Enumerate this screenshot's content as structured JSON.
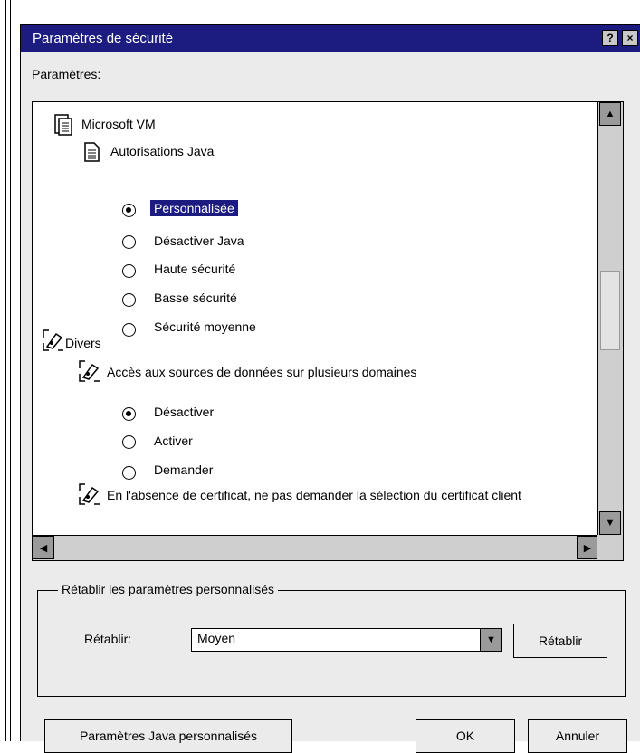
{
  "window": {
    "title": "Paramètres de sécurité",
    "help_button": "?",
    "close_button": "×"
  },
  "settings_label": "Paramètres:",
  "tree": {
    "microsoft_vm": "Microsoft VM",
    "java_permissions": "Autorisations Java",
    "java_options": [
      {
        "label": "Personnalisée",
        "checked": true
      },
      {
        "label": "Désactiver Java",
        "checked": false
      },
      {
        "label": "Haute sécurité",
        "checked": false
      },
      {
        "label": "Basse sécurité",
        "checked": false
      },
      {
        "label": "Sécurité moyenne",
        "checked": false
      }
    ],
    "misc": "Divers",
    "data_access": "Accès aux sources de données sur plusieurs domaines",
    "data_access_options": [
      {
        "label": "Désactiver",
        "checked": true
      },
      {
        "label": "Activer",
        "checked": false
      },
      {
        "label": "Demander",
        "checked": false
      }
    ],
    "no_cert": "En l'absence de certificat, ne pas demander la sélection du certificat client"
  },
  "reset_group": {
    "title": "Rétablir les paramètres personnalisés",
    "reset_label": "Rétablir:",
    "combo_value": "Moyen",
    "reset_button": "Rétablir"
  },
  "footer": {
    "java_custom_button": "Paramètres Java personnalisés",
    "ok_button": "OK",
    "cancel_button": "Annuler"
  },
  "colors": {
    "titlebar": "#1c1c80",
    "selection": "#1c1c80"
  }
}
